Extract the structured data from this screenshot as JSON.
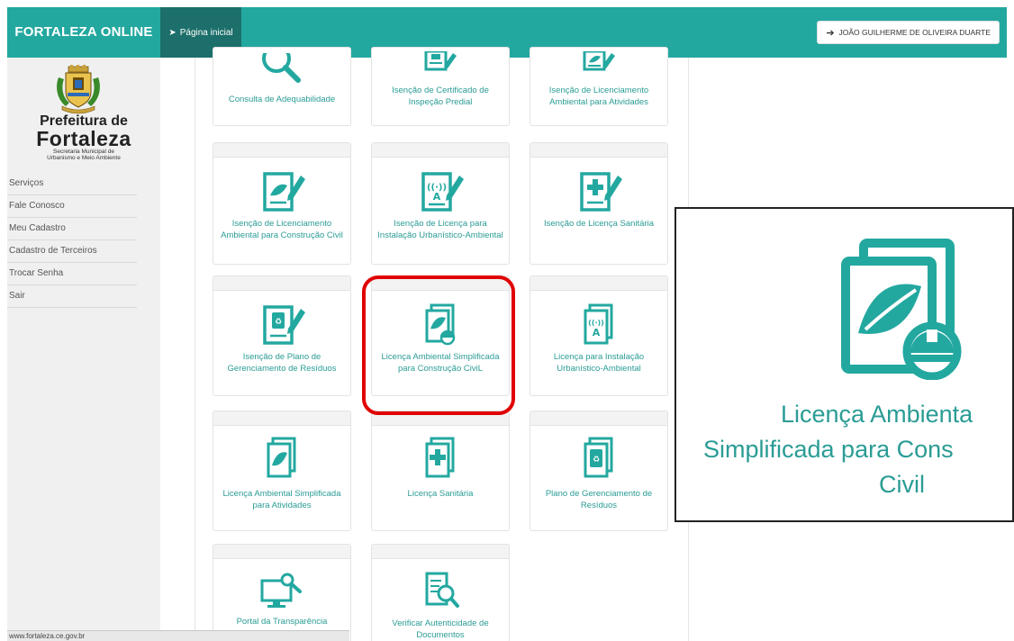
{
  "header": {
    "brand": "FORTALEZA ONLINE",
    "home_link": "Página inicial",
    "user_button": "JOÃO GUILHERME DE OLIVEIRA DUARTE"
  },
  "sidebar": {
    "logo": {
      "line1": "Prefeitura de",
      "line2": "Fortaleza",
      "line3a": "Secretaria Municipal de",
      "line3b": "Urbanismo e Meio Ambiente"
    },
    "items": [
      "Serviços",
      "Fale Conosco",
      "Meu Cadastro",
      "Cadastro de Terceiros",
      "Trocar Senha",
      "Sair"
    ]
  },
  "services": [
    {
      "label": "Consulta de Adequabilidade",
      "icon": "magnifier-icon"
    },
    {
      "label": "Isenção de Certificado de Inspeção Predial",
      "icon": "building-document-icon"
    },
    {
      "label": "Isenção de Licenciamento Ambiental para Atividades",
      "icon": "leaf-document-icon"
    },
    {
      "label": "Isenção de Licenciamento Ambiental para Construção Civil",
      "icon": "leaf-document-pen-icon"
    },
    {
      "label": "Isenção de Licença para Instalação Urbanístico-Ambiental",
      "icon": "antenna-document-pen-icon"
    },
    {
      "label": "Isenção de Licença Sanitária",
      "icon": "health-document-pen-icon"
    },
    {
      "label": "Isenção de Plano de Gerenciamento de Resíduos",
      "icon": "recycle-document-pen-icon"
    },
    {
      "label": "Licença Ambiental Simplificada para Construção CiviL",
      "icon": "leaf-helmet-document-icon"
    },
    {
      "label": "Licença para Instalação Urbanístico-Ambiental",
      "icon": "antenna-document-icon"
    },
    {
      "label": "Licença Ambiental Simplificada para Atividades",
      "icon": "leaf-document-icon"
    },
    {
      "label": "Licença Sanitária",
      "icon": "health-document-icon"
    },
    {
      "label": "Plano de Gerenciamento de Resíduos",
      "icon": "recycle-document-icon"
    },
    {
      "label": "Portal da Transparência",
      "icon": "monitor-magnifier-icon"
    },
    {
      "label": "Verificar Autenticidade de Documentos",
      "icon": "document-magnifier-icon"
    }
  ],
  "zoom": {
    "line1": "Licença Ambienta",
    "line2": "Simplificada para Cons",
    "line3": "Civil"
  },
  "status_url": "www.fortaleza.ce.gov.br",
  "colors": {
    "teal": "#23a8a0",
    "dark_teal": "#1c6f6a",
    "highlight": "#e00000"
  }
}
